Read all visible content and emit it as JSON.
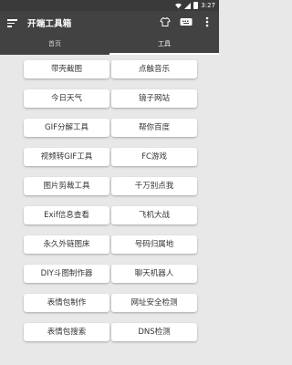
{
  "status_bar": {
    "time": "3:27"
  },
  "app": {
    "title": "开端工具箱"
  },
  "toolbar_icons": [
    "shirt-icon",
    "keyboard-icon",
    "more-vert-icon"
  ],
  "tabs": [
    {
      "label": "首页",
      "active": false
    },
    {
      "label": "工具",
      "active": true
    }
  ],
  "tools": {
    "left": [
      "带壳截图",
      "今日天气",
      "GIF分解工具",
      "视频转GIF工具",
      "图片剪裁工具",
      "Exif信息查看",
      "永久外链图床",
      "DIY斗图制作器",
      "表情包制作",
      "表情包搜索"
    ],
    "right": [
      "点触音乐",
      "镜子网站",
      "帮你百度",
      "FC游戏",
      "千万别点我",
      "飞机大战",
      "号码归属地",
      "聊天机器人",
      "网址安全检测",
      "DNS检测"
    ]
  }
}
